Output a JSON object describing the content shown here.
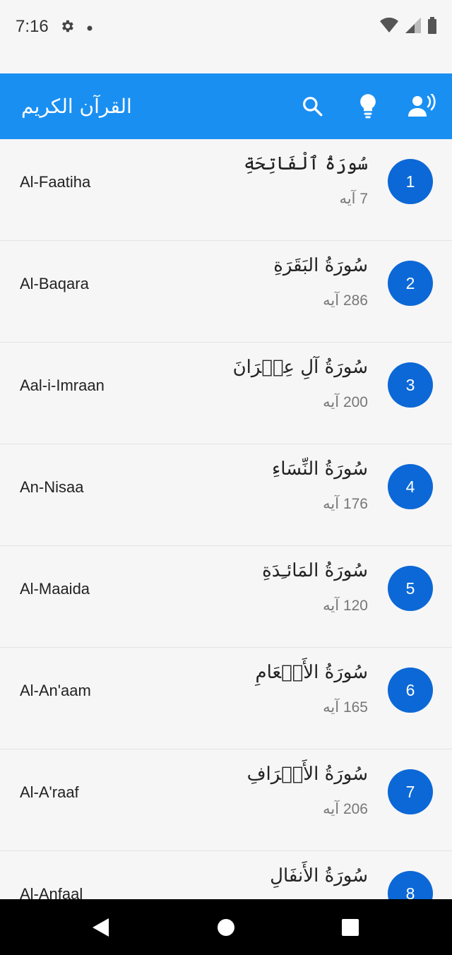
{
  "status_bar": {
    "time": "7:16",
    "icons": [
      "settings-icon",
      "dot-icon",
      "wifi-icon",
      "signal-icon",
      "battery-icon"
    ]
  },
  "app_bar": {
    "title": "القرآن الكريم",
    "background_color": "#1a8ff2",
    "actions": [
      "search-icon",
      "lightbulb-icon",
      "recitation-icon"
    ]
  },
  "surahs": [
    {
      "number": "1",
      "arabic": "سُورَةُ ٱلْفَاتِحَةِ",
      "ayah_count": "7 آيه",
      "english": "Al-Faatiha"
    },
    {
      "number": "2",
      "arabic": "سُورَةُ البَقَرَةِ",
      "ayah_count": "286 آيه",
      "english": "Al-Baqara"
    },
    {
      "number": "3",
      "arabic": "سُورَةُ آلِ عِمۡرَانَ",
      "ayah_count": "200 آيه",
      "english": "Aal-i-Imraan"
    },
    {
      "number": "4",
      "arabic": "سُورَةُ النِّسَاءِ",
      "ayah_count": "176 آيه",
      "english": "An-Nisaa"
    },
    {
      "number": "5",
      "arabic": "سُورَةُ المَائـِدَةِ",
      "ayah_count": "120 آيه",
      "english": "Al-Maaida"
    },
    {
      "number": "6",
      "arabic": "سُورَةُ الأَنۡعَامِ",
      "ayah_count": "165 آيه",
      "english": "Al-An'aam"
    },
    {
      "number": "7",
      "arabic": "سُورَةُ الأَعۡرَافِ",
      "ayah_count": "206 آيه",
      "english": "Al-A'raaf"
    },
    {
      "number": "8",
      "arabic": "سُورَةُ الأَنفَالِ",
      "ayah_count": "",
      "english": "Al-Anfaal"
    }
  ],
  "colors": {
    "number_circle": "#0c68d6",
    "background": "#f6f6f6"
  },
  "nav_bar": {
    "buttons": [
      "back-icon",
      "home-icon",
      "recents-icon"
    ]
  }
}
